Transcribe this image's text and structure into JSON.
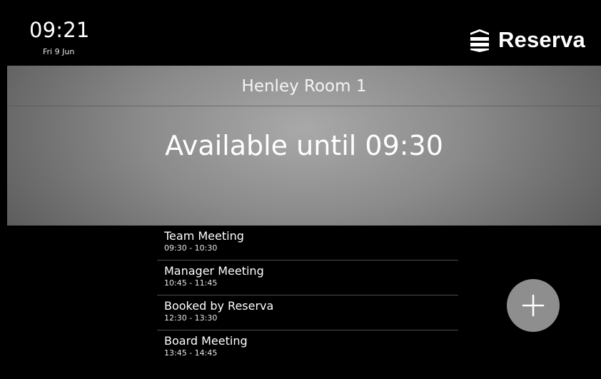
{
  "header": {
    "time": "09:21",
    "date": "Fri 9 Jun",
    "brand": "Reserva",
    "brand_icon": "stacked-layers-logo-icon"
  },
  "room": {
    "name": "Henley Room 1",
    "status": "Available until 09:30"
  },
  "bookings": [
    {
      "title": "Team Meeting",
      "time": "09:30 - 10:30"
    },
    {
      "title": "Manager Meeting",
      "time": "10:45 - 11:45"
    },
    {
      "title": "Booked by Reserva",
      "time": "12:30 - 13:30"
    },
    {
      "title": "Board Meeting",
      "time": "13:45 - 14:45"
    }
  ],
  "actions": {
    "add_icon": "plus-icon"
  },
  "colors": {
    "background": "#000000",
    "hero_center": "#a9a9a9",
    "hero_edge": "#5a5a5a",
    "add_button": "#8e8e8e",
    "divider": "#4a4a4a"
  }
}
